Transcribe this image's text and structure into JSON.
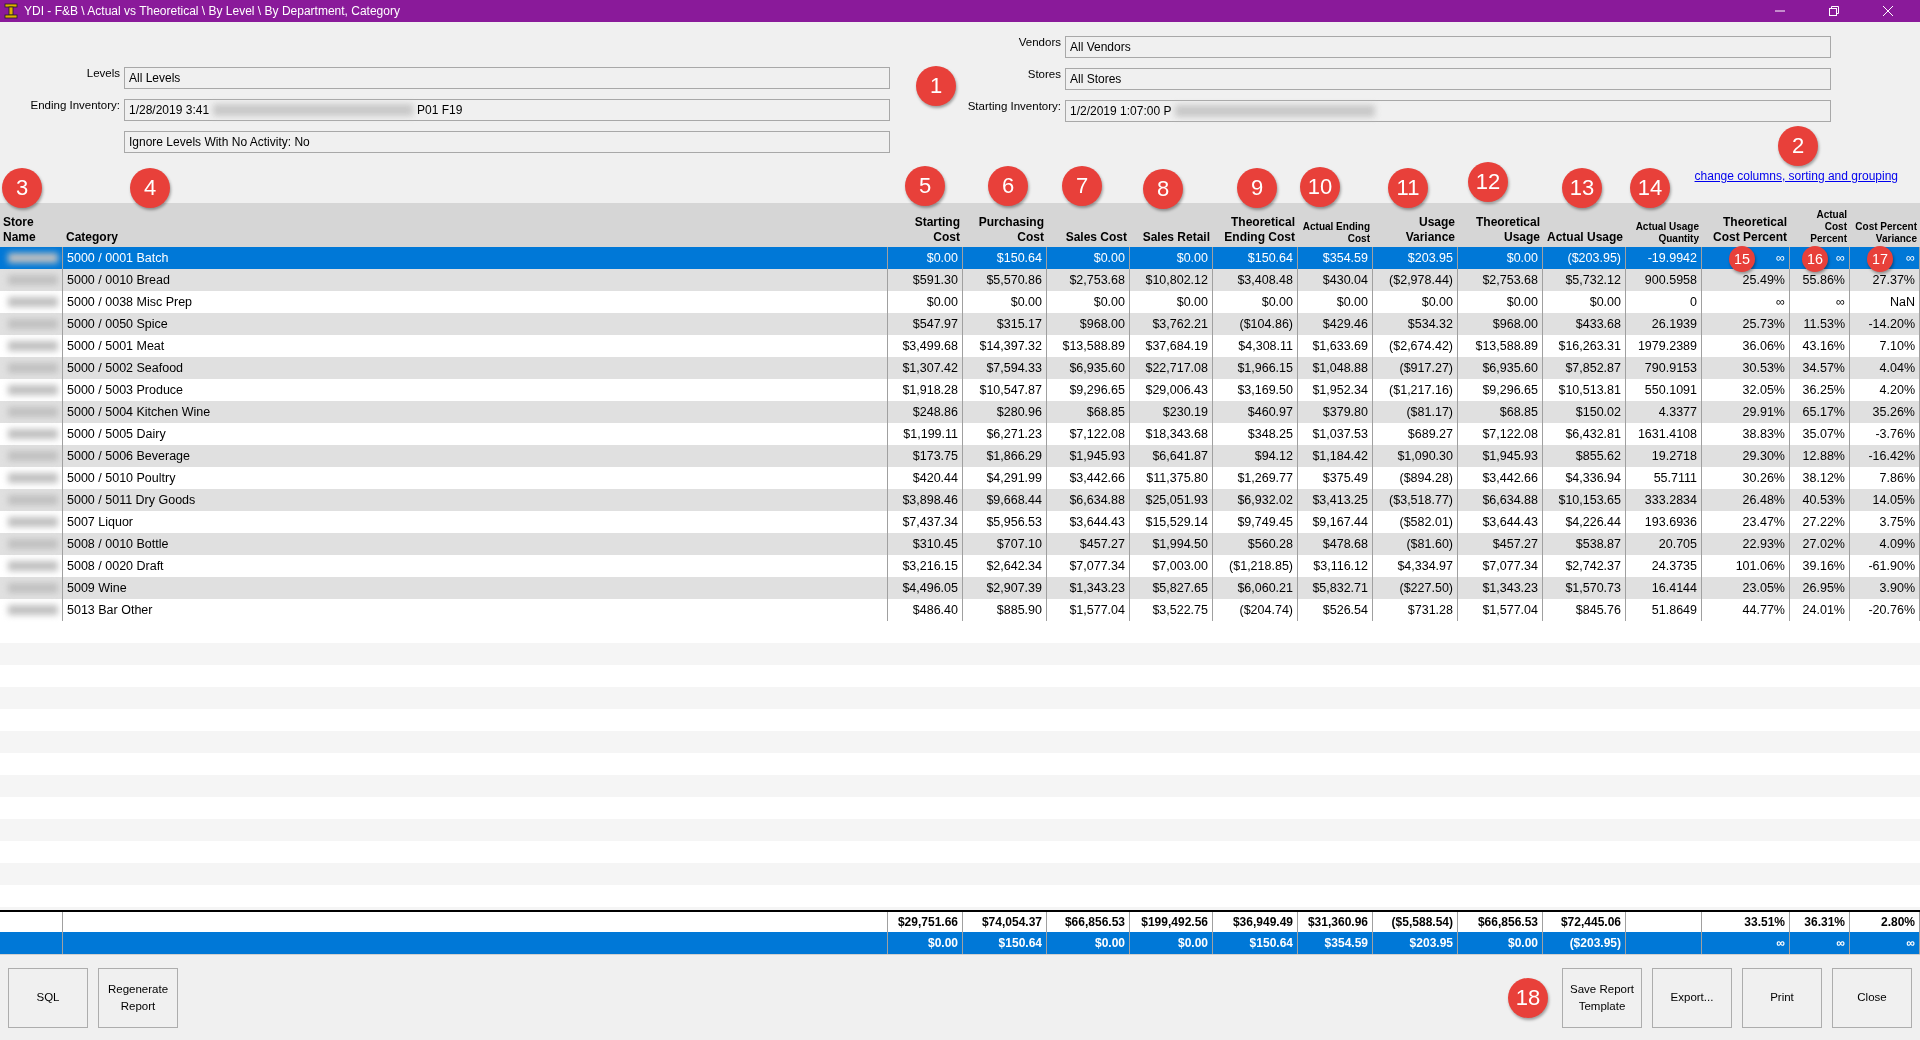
{
  "window": {
    "title": "YDI - F&B \\ Actual vs Theoretical \\ By Level \\ By Department, Category"
  },
  "filters_left": [
    {
      "label": "Levels",
      "value_start": "All Levels",
      "blurred": false
    },
    {
      "label": "Ending Inventory:",
      "value_start": "1/28/2019 3:41",
      "blurred": true,
      "value_end": "P01 F19"
    },
    {
      "value_start": "Ignore Levels With No Activity: No",
      "blurred": false
    }
  ],
  "filters_right": [
    {
      "label": "Vendors",
      "value_start": "All Vendors",
      "blurred": false
    },
    {
      "label": "Stores",
      "value_start": "All Stores",
      "blurred": false
    },
    {
      "label": "Starting Inventory:",
      "value_start": "1/2/2019 1:07:00 P",
      "blurred": true
    }
  ],
  "link": "change columns, sorting and grouping",
  "table": {
    "columns": [
      {
        "label": "Store Name",
        "kind": "regular"
      },
      {
        "label": "Category",
        "kind": "regular"
      },
      {
        "label": "Starting Cost",
        "kind": "regular"
      },
      {
        "label": "Purchasing Cost",
        "kind": "regular"
      },
      {
        "label": "Sales Cost",
        "kind": "regular"
      },
      {
        "label": "Sales Retail",
        "kind": "regular"
      },
      {
        "label": "Theoretical Ending Cost",
        "kind": "regular"
      },
      {
        "label": "Actual Ending Cost",
        "kind": "small"
      },
      {
        "label": "Usage Variance",
        "kind": "regular"
      },
      {
        "label": "Theoretical Usage",
        "kind": "regular"
      },
      {
        "label": "Actual Usage",
        "kind": "regular"
      },
      {
        "label": "Actual Usage Quantity",
        "kind": "small"
      },
      {
        "label": "Theoretical Cost Percent",
        "kind": "regular"
      },
      {
        "label": "Actual Cost Percent",
        "kind": "small"
      },
      {
        "label": "Cost Percent Variance",
        "kind": "small"
      }
    ],
    "rows": [
      {
        "selected": true,
        "category": "5000 / 0001 Batch",
        "values": [
          "$0.00",
          "$150.64",
          "$0.00",
          "$0.00",
          "$150.64",
          "$354.59",
          "$203.95",
          "$0.00",
          "($203.95)",
          "-19.9942",
          "∞",
          "∞",
          "∞"
        ]
      },
      {
        "selected": false,
        "category": "5000 / 0010 Bread",
        "values": [
          "$591.30",
          "$5,570.86",
          "$2,753.68",
          "$10,802.12",
          "$3,408.48",
          "$430.04",
          "($2,978.44)",
          "$2,753.68",
          "$5,732.12",
          "900.5958",
          "25.49%",
          "55.86%",
          "27.37%"
        ]
      },
      {
        "selected": false,
        "category": "5000 / 0038 Misc Prep",
        "values": [
          "$0.00",
          "$0.00",
          "$0.00",
          "$0.00",
          "$0.00",
          "$0.00",
          "$0.00",
          "$0.00",
          "$0.00",
          "0",
          "∞",
          "∞",
          "NaN"
        ]
      },
      {
        "selected": false,
        "category": "5000 / 0050 Spice",
        "values": [
          "$547.97",
          "$315.17",
          "$968.00",
          "$3,762.21",
          "($104.86)",
          "$429.46",
          "$534.32",
          "$968.00",
          "$433.68",
          "26.1939",
          "25.73%",
          "11.53%",
          "-14.20%"
        ]
      },
      {
        "selected": false,
        "category": "5000 / 5001 Meat",
        "values": [
          "$3,499.68",
          "$14,397.32",
          "$13,588.89",
          "$37,684.19",
          "$4,308.11",
          "$1,633.69",
          "($2,674.42)",
          "$13,588.89",
          "$16,263.31",
          "1979.2389",
          "36.06%",
          "43.16%",
          "7.10%"
        ]
      },
      {
        "selected": false,
        "category": "5000 / 5002 Seafood",
        "values": [
          "$1,307.42",
          "$7,594.33",
          "$6,935.60",
          "$22,717.08",
          "$1,966.15",
          "$1,048.88",
          "($917.27)",
          "$6,935.60",
          "$7,852.87",
          "790.9153",
          "30.53%",
          "34.57%",
          "4.04%"
        ]
      },
      {
        "selected": false,
        "category": "5000 / 5003 Produce",
        "values": [
          "$1,918.28",
          "$10,547.87",
          "$9,296.65",
          "$29,006.43",
          "$3,169.50",
          "$1,952.34",
          "($1,217.16)",
          "$9,296.65",
          "$10,513.81",
          "550.1091",
          "32.05%",
          "36.25%",
          "4.20%"
        ]
      },
      {
        "selected": false,
        "category": "5000 / 5004 Kitchen Wine",
        "values": [
          "$248.86",
          "$280.96",
          "$68.85",
          "$230.19",
          "$460.97",
          "$379.80",
          "($81.17)",
          "$68.85",
          "$150.02",
          "4.3377",
          "29.91%",
          "65.17%",
          "35.26%"
        ]
      },
      {
        "selected": false,
        "category": "5000 / 5005 Dairy",
        "values": [
          "$1,199.11",
          "$6,271.23",
          "$7,122.08",
          "$18,343.68",
          "$348.25",
          "$1,037.53",
          "$689.27",
          "$7,122.08",
          "$6,432.81",
          "1631.4108",
          "38.83%",
          "35.07%",
          "-3.76%"
        ]
      },
      {
        "selected": false,
        "category": "5000 / 5006 Beverage",
        "values": [
          "$173.75",
          "$1,866.29",
          "$1,945.93",
          "$6,641.87",
          "$94.12",
          "$1,184.42",
          "$1,090.30",
          "$1,945.93",
          "$855.62",
          "19.2718",
          "29.30%",
          "12.88%",
          "-16.42%"
        ]
      },
      {
        "selected": false,
        "category": "5000 / 5010 Poultry",
        "values": [
          "$420.44",
          "$4,291.99",
          "$3,442.66",
          "$11,375.80",
          "$1,269.77",
          "$375.49",
          "($894.28)",
          "$3,442.66",
          "$4,336.94",
          "55.7111",
          "30.26%",
          "38.12%",
          "7.86%"
        ]
      },
      {
        "selected": false,
        "category": "5000 / 5011 Dry Goods",
        "values": [
          "$3,898.46",
          "$9,668.44",
          "$6,634.88",
          "$25,051.93",
          "$6,932.02",
          "$3,413.25",
          "($3,518.77)",
          "$6,634.88",
          "$10,153.65",
          "333.2834",
          "26.48%",
          "40.53%",
          "14.05%"
        ]
      },
      {
        "selected": false,
        "category": "5007 Liquor",
        "values": [
          "$7,437.34",
          "$5,956.53",
          "$3,644.43",
          "$15,529.14",
          "$9,749.45",
          "$9,167.44",
          "($582.01)",
          "$3,644.43",
          "$4,226.44",
          "193.6936",
          "23.47%",
          "27.22%",
          "3.75%"
        ]
      },
      {
        "selected": false,
        "category": "5008 / 0010 Bottle",
        "values": [
          "$310.45",
          "$707.10",
          "$457.27",
          "$1,994.50",
          "$560.28",
          "$478.68",
          "($81.60)",
          "$457.27",
          "$538.87",
          "20.705",
          "22.93%",
          "27.02%",
          "4.09%"
        ]
      },
      {
        "selected": false,
        "category": "5008 / 0020 Draft",
        "values": [
          "$3,216.15",
          "$2,642.34",
          "$7,077.34",
          "$7,003.00",
          "($1,218.85)",
          "$3,116.12",
          "$4,334.97",
          "$7,077.34",
          "$2,742.37",
          "24.3735",
          "101.06%",
          "39.16%",
          "-61.90%"
        ]
      },
      {
        "selected": false,
        "category": "5009 Wine",
        "values": [
          "$4,496.05",
          "$2,907.39",
          "$1,343.23",
          "$5,827.65",
          "$6,060.21",
          "$5,832.71",
          "($227.50)",
          "$1,343.23",
          "$1,570.73",
          "16.4144",
          "23.05%",
          "26.95%",
          "3.90%"
        ]
      },
      {
        "selected": false,
        "category": "5013 Bar Other",
        "values": [
          "$486.40",
          "$885.90",
          "$1,577.04",
          "$3,522.75",
          "($204.74)",
          "$526.54",
          "$731.28",
          "$1,577.04",
          "$845.76",
          "51.8649",
          "44.77%",
          "24.01%",
          "-20.76%"
        ]
      }
    ],
    "totals": [
      "$29,751.66",
      "$74,054.37",
      "$66,856.53",
      "$199,492.56",
      "$36,949.49",
      "$31,360.96",
      "($5,588.54)",
      "$66,856.53",
      "$72,445.06",
      "33.51%",
      "36.31%",
      "2.80%"
    ],
    "selection_totals": [
      "$0.00",
      "$150.64",
      "$0.00",
      "$0.00",
      "$150.64",
      "$354.59",
      "$203.95",
      "$0.00",
      "($203.95)",
      "∞",
      "∞",
      "∞"
    ]
  },
  "buttons_left": [
    "SQL",
    "Regenerate Report"
  ],
  "buttons_right": [
    "Save Report Template",
    "Export...",
    "Print",
    "Close"
  ],
  "callouts": [
    "1",
    "2",
    "3",
    "4",
    "5",
    "6",
    "7",
    "8",
    "9",
    "10",
    "11",
    "12",
    "13",
    "14",
    "15",
    "16",
    "17",
    "18"
  ]
}
